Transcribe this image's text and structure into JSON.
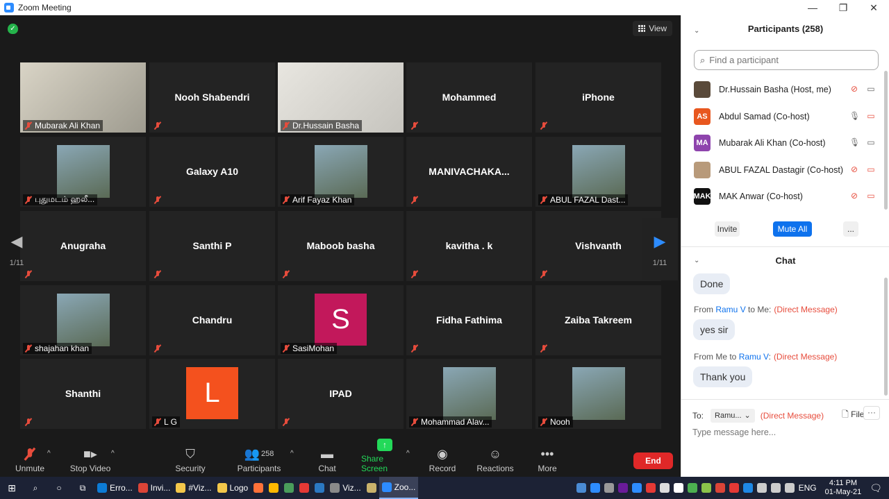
{
  "window": {
    "title": "Zoom Meeting",
    "minimize": "—",
    "restore": "❐",
    "close": "✕"
  },
  "stage": {
    "view_label": "View",
    "page_left": "1/11",
    "page_right": "1/11"
  },
  "tiles": [
    {
      "name": "Mubarak Ali Khan",
      "label": "Mubarak Ali Khan",
      "kind": "video",
      "active": true
    },
    {
      "name": "Nooh Shabendri",
      "kind": "name"
    },
    {
      "name": "Dr.Hussain Basha",
      "label": "Dr.Hussain Basha",
      "kind": "video"
    },
    {
      "name": "Mohammed",
      "kind": "name"
    },
    {
      "name": "iPhone",
      "kind": "name"
    },
    {
      "label": "புதுமடம் ஹலீ...",
      "kind": "photo"
    },
    {
      "name": "Galaxy A10",
      "kind": "name"
    },
    {
      "label": "Arif Fayaz Khan",
      "kind": "photo"
    },
    {
      "name": "MANIVACHAKA...",
      "kind": "name"
    },
    {
      "label": "ABUL FAZAL Dast...",
      "kind": "photo"
    },
    {
      "name": "Anugraha",
      "kind": "name"
    },
    {
      "name": "Santhi P",
      "kind": "name"
    },
    {
      "name": "Maboob basha",
      "kind": "name"
    },
    {
      "name": "kavitha . k",
      "kind": "name"
    },
    {
      "name": "Vishvanth",
      "kind": "name"
    },
    {
      "label": "shajahan khan",
      "kind": "photo"
    },
    {
      "name": "Chandru",
      "kind": "name"
    },
    {
      "label": "SasiMohan",
      "kind": "letter",
      "letter": "S",
      "color": "#c2185b"
    },
    {
      "name": "Fidha Fathima",
      "kind": "name"
    },
    {
      "name": "Zaiba Takreem",
      "kind": "name"
    },
    {
      "name": "Shanthi",
      "kind": "name"
    },
    {
      "label": "L G",
      "kind": "letter",
      "letter": "L",
      "color": "#f4511e"
    },
    {
      "name": "IPAD",
      "kind": "name"
    },
    {
      "label": "Mohammad Alav...",
      "kind": "photo"
    },
    {
      "label": "Nooh",
      "kind": "photo"
    }
  ],
  "toolbar": {
    "unmute": "Unmute",
    "stop_video": "Stop Video",
    "security": "Security",
    "participants": "Participants",
    "participants_count": "258",
    "chat": "Chat",
    "share_screen": "Share Screen",
    "record": "Record",
    "reactions": "Reactions",
    "more": "More",
    "end": "End"
  },
  "participants": {
    "title": "Participants (258)",
    "search_placeholder": "Find a participant",
    "list": [
      {
        "name": "Dr.Hussain Basha (Host, me)",
        "avatar": "",
        "color": "#5a4a3a"
      },
      {
        "name": "Abdul Samad (Co-host)",
        "avatar": "AS",
        "color": "#e8571f"
      },
      {
        "name": "Mubarak Ali Khan (Co-host)",
        "avatar": "MA",
        "color": "#8e44ad"
      },
      {
        "name": "ABUL FAZAL Dastagir (Co-host)",
        "avatar": "",
        "color": "#b89a7a"
      },
      {
        "name": "MAK Anwar (Co-host)",
        "avatar": "MAK",
        "color": "#111111"
      }
    ],
    "invite": "Invite",
    "mute_all": "Mute All",
    "more": "..."
  },
  "chat": {
    "title": "Chat",
    "messages": [
      {
        "text": "Done"
      },
      {
        "from_prefix": "From ",
        "from": "Ramu V",
        "to_part": " to Me:",
        "dm": "(Direct Message)",
        "text": "yes sir"
      },
      {
        "from_prefix": "From Me to ",
        "from": "Ramu V",
        "to_part": ":",
        "dm": "(Direct Message)",
        "text": "Thank you"
      }
    ],
    "to_label": "To:",
    "to_value": "Ramu...",
    "to_dm": "(Direct Message)",
    "file": "File",
    "more": "···",
    "input_placeholder": "Type message here..."
  },
  "taskbar": {
    "items": [
      {
        "label": "Erro...",
        "color": "#0c7bd6"
      },
      {
        "label": "Invi...",
        "color": "#db4437"
      },
      {
        "label": "#Viz...",
        "color": "#f3c74a"
      },
      {
        "label": "Logo",
        "color": "#f3c74a"
      },
      {
        "label": "",
        "color": "#ff7139"
      },
      {
        "label": "",
        "color": "#ffb900"
      },
      {
        "label": "",
        "color": "#4a9d5b"
      },
      {
        "label": "",
        "color": "#e53935"
      },
      {
        "label": "",
        "color": "#2b78c2"
      },
      {
        "label": "Viz...",
        "color": "#8a8a8a"
      },
      {
        "label": "",
        "color": "#c9b26b"
      },
      {
        "label": "Zoo...",
        "color": "#2d8cff"
      }
    ],
    "lang": "ENG",
    "time": "4:11 PM",
    "date": "01-May-21"
  }
}
